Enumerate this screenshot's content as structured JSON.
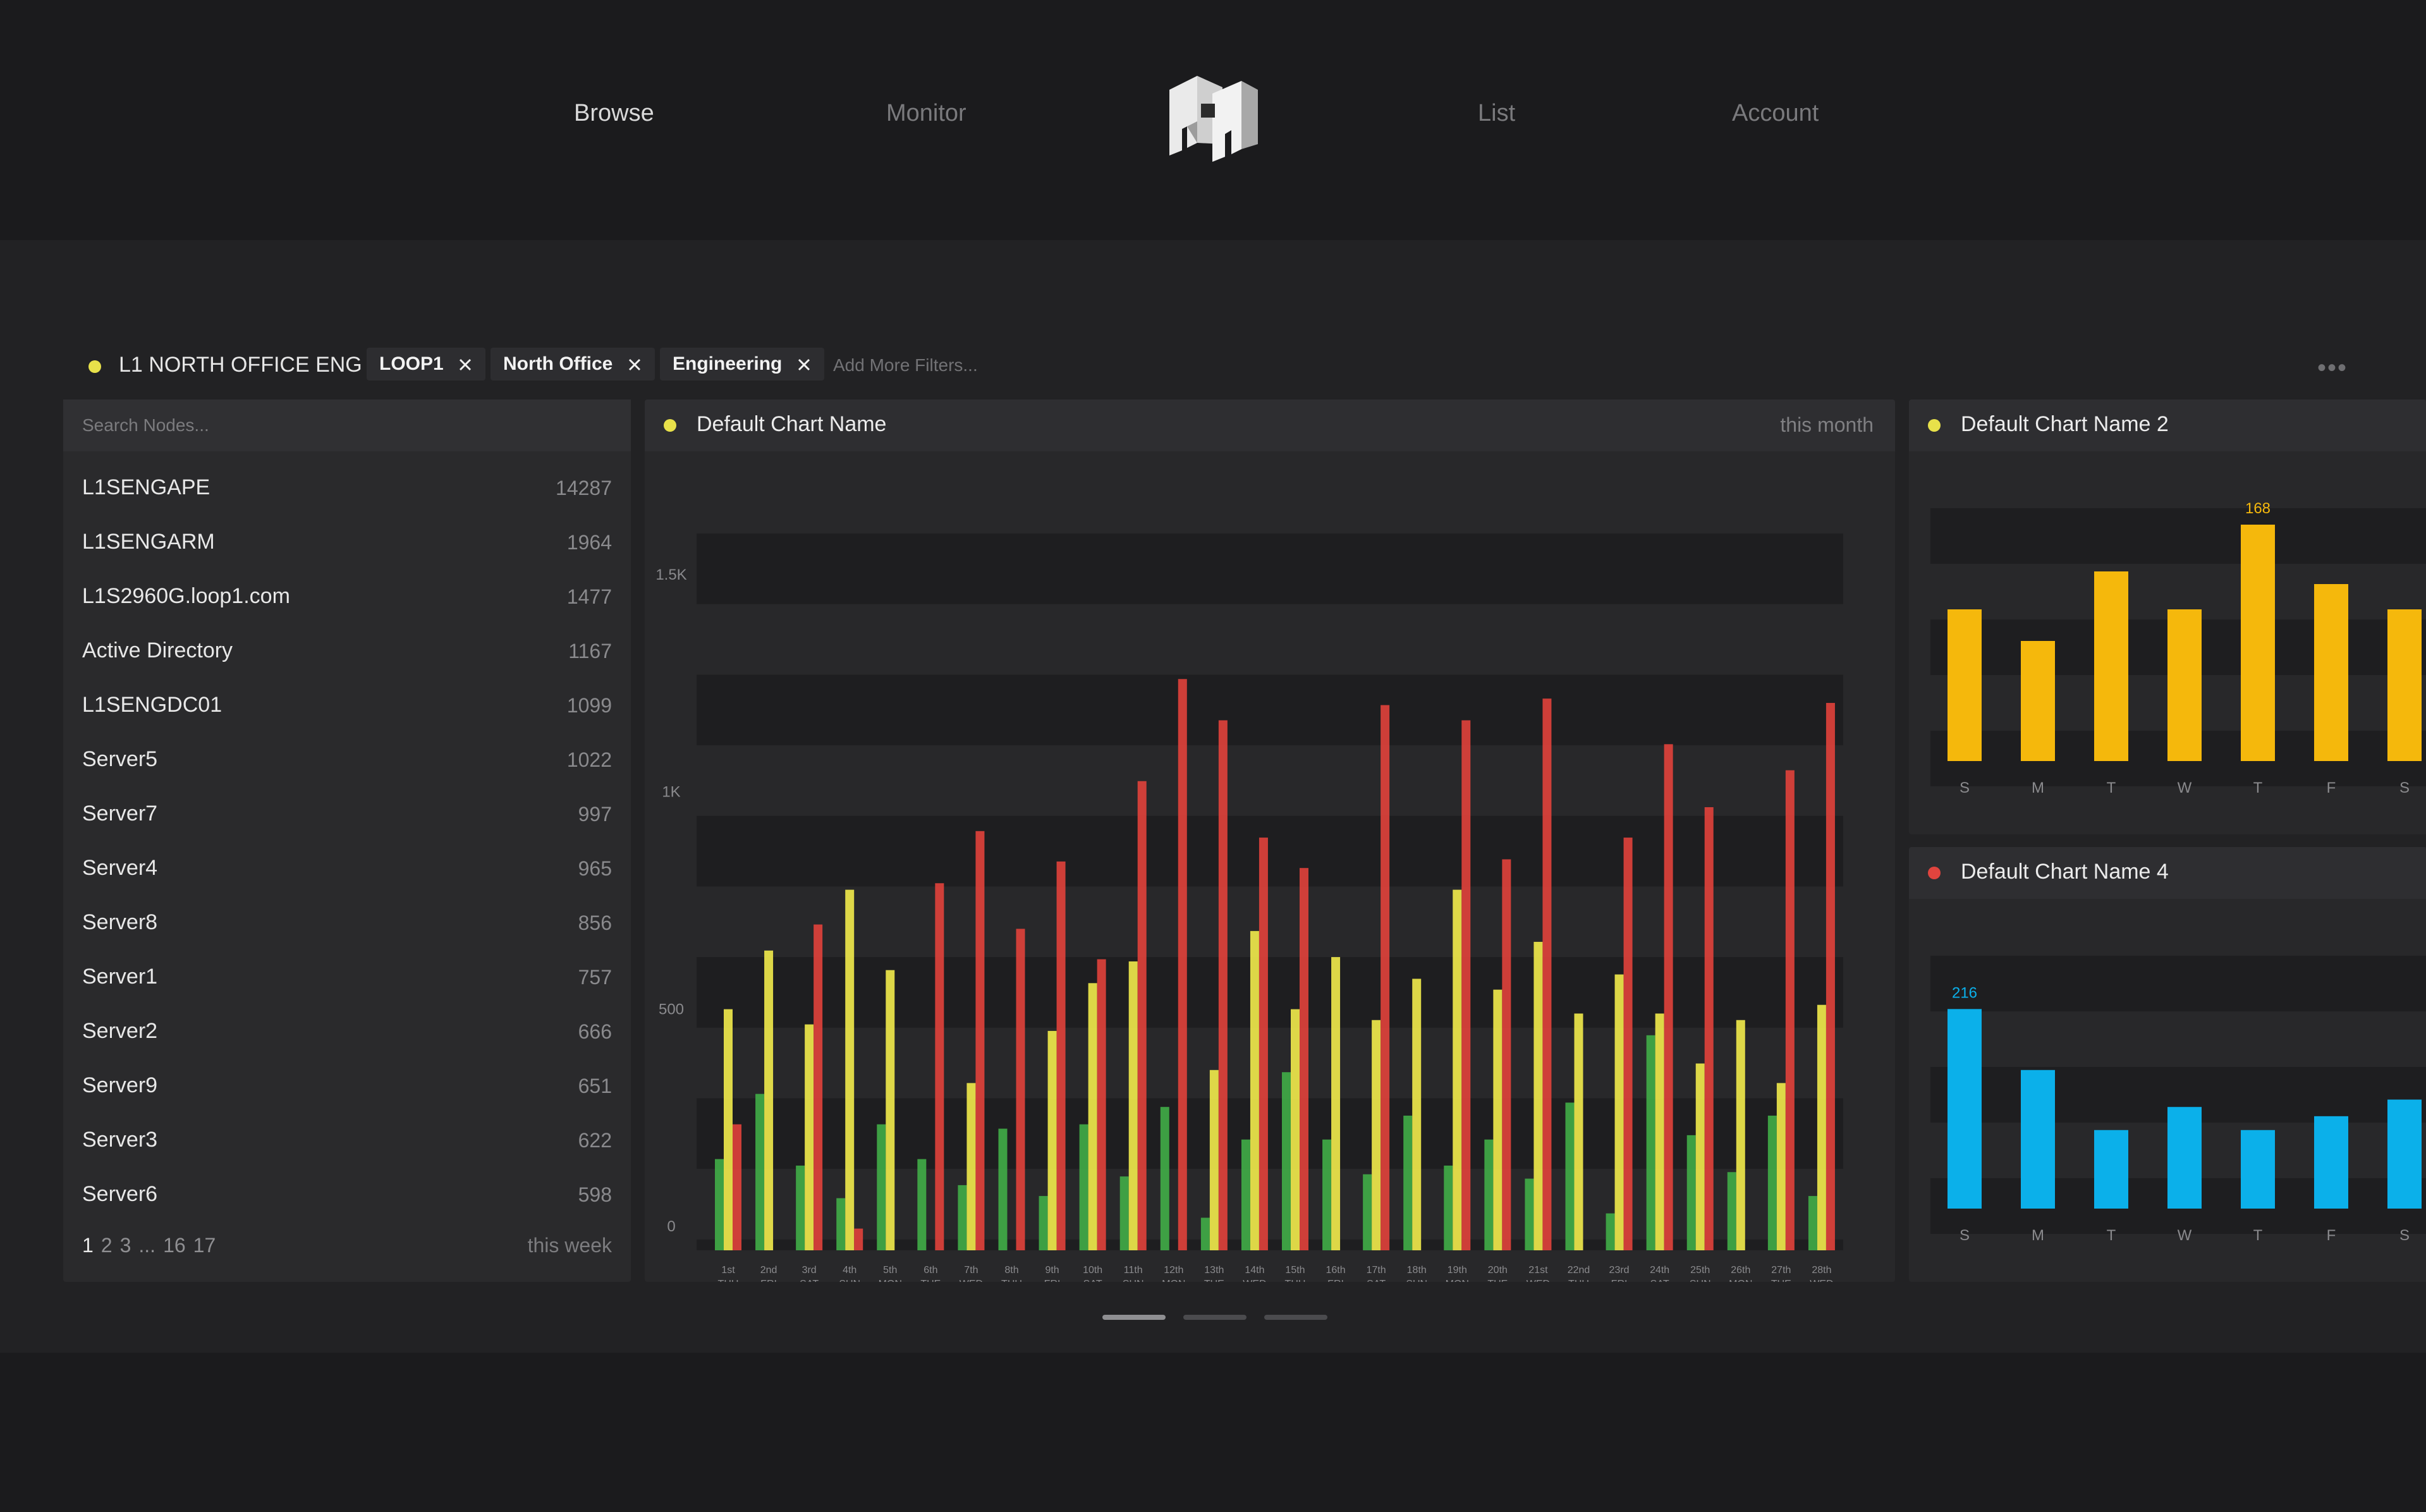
{
  "nav": {
    "items": [
      "Browse",
      "Monitor",
      "List",
      "Account"
    ],
    "active": "Browse"
  },
  "filters": {
    "title": "L1 NORTH OFFICE ENG",
    "title_color": "#e8e14a",
    "chips": [
      "LOOP1",
      "North Office",
      "Engineering"
    ],
    "add_placeholder": "Add More Filters...",
    "more_icon": "more-dots-icon"
  },
  "nodes": {
    "search_placeholder": "Search Nodes...",
    "items": [
      {
        "name": "L1SENGAPE",
        "count": "14287"
      },
      {
        "name": "L1SENGARM",
        "count": "1964"
      },
      {
        "name": "L1S2960G.loop1.com",
        "count": "1477"
      },
      {
        "name": "Active Directory",
        "count": "1167"
      },
      {
        "name": "L1SENGDC01",
        "count": "1099"
      },
      {
        "name": "Server5",
        "count": "1022"
      },
      {
        "name": "Server7",
        "count": "997"
      },
      {
        "name": "Server4",
        "count": "965"
      },
      {
        "name": "Server8",
        "count": "856"
      },
      {
        "name": "Server1",
        "count": "757"
      },
      {
        "name": "Server2",
        "count": "666"
      },
      {
        "name": "Server9",
        "count": "651"
      },
      {
        "name": "Server3",
        "count": "622"
      },
      {
        "name": "Server6",
        "count": "598"
      }
    ],
    "pages": [
      "1",
      "2",
      "3",
      "...",
      "16",
      "17"
    ],
    "current_page": "1",
    "period": "this week"
  },
  "main_panel": {
    "title": "Default Chart Name",
    "period": "this month",
    "dot_color": "#e8e14a"
  },
  "side_panels": [
    {
      "title": "Default Chart Name 2",
      "dot_color": "#e8e14a"
    },
    {
      "title": "Default Chart Name 4",
      "dot_color": "#e0443e"
    }
  ],
  "colors": {
    "green": "#3fa646",
    "yellow": "#e8e14a",
    "red": "#d8403a",
    "orange": "#f5b80c",
    "blue": "#0bb0ea"
  },
  "chart_data": [
    {
      "type": "bar",
      "title": "Default Chart Name",
      "y_ticks": [
        "0",
        "500",
        "1K",
        "1.5K"
      ],
      "ylim": [
        0,
        1650
      ],
      "categories": [
        [
          "1st",
          "THU"
        ],
        [
          "2nd",
          "FRI"
        ],
        [
          "3rd",
          "SAT"
        ],
        [
          "4th",
          "SUN"
        ],
        [
          "5th",
          "MON"
        ],
        [
          "6th",
          "TUE"
        ],
        [
          "7th",
          "WED"
        ],
        [
          "8th",
          "THU"
        ],
        [
          "9th",
          "FRI"
        ],
        [
          "10th",
          "SAT"
        ],
        [
          "11th",
          "SUN"
        ],
        [
          "12th",
          "MON"
        ],
        [
          "13th",
          "TUE"
        ],
        [
          "14th",
          "WED"
        ],
        [
          "15th",
          "THU"
        ],
        [
          "16th",
          "FRI"
        ],
        [
          "17th",
          "SAT"
        ],
        [
          "18th",
          "SUN"
        ],
        [
          "19th",
          "MON"
        ],
        [
          "20th",
          "TUE"
        ],
        [
          "21st",
          "WED"
        ],
        [
          "22nd",
          "THU"
        ],
        [
          "23rd",
          "FRI"
        ],
        [
          "24th",
          "SAT"
        ],
        [
          "25th",
          "SUN"
        ],
        [
          "26th",
          "MON"
        ],
        [
          "27th",
          "TUE"
        ],
        [
          "28th",
          "WED"
        ]
      ],
      "series": [
        {
          "color": "green",
          "values": [
            210,
            360,
            195,
            120,
            290,
            210,
            150,
            280,
            125,
            290,
            170,
            330,
            75,
            255,
            410,
            255,
            175,
            310,
            195,
            255,
            165,
            340,
            85,
            495,
            265,
            180,
            310,
            125
          ]
        },
        {
          "color": "yellow",
          "values": [
            555,
            690,
            520,
            830,
            645,
            0,
            385,
            0,
            505,
            615,
            665,
            0,
            415,
            735,
            555,
            675,
            530,
            625,
            830,
            600,
            710,
            545,
            635,
            545,
            430,
            530,
            385,
            565
          ]
        },
        {
          "color": "red",
          "values": [
            290,
            0,
            750,
            50,
            0,
            845,
            965,
            740,
            895,
            670,
            1080,
            1315,
            1220,
            950,
            880,
            0,
            1255,
            0,
            1220,
            900,
            1270,
            0,
            950,
            1165,
            1020,
            0,
            1105,
            1260
          ]
        }
      ]
    },
    {
      "type": "bar",
      "title": "Default Chart Name 2",
      "categories": [
        "S",
        "M",
        "T",
        "W",
        "T",
        "F",
        "S"
      ],
      "values": [
        120,
        95,
        150,
        120,
        187,
        140,
        120
      ],
      "ylim": [
        0,
        190
      ],
      "labels": {
        "4": "168"
      },
      "color": "orange"
    },
    {
      "type": "bar",
      "title": "Default Chart Name 4",
      "categories": [
        "S",
        "M",
        "T",
        "W",
        "T",
        "F",
        "S"
      ],
      "values": [
        216,
        150,
        85,
        110,
        85,
        100,
        118
      ],
      "ylim": [
        0,
        260
      ],
      "labels": {
        "0": "216"
      },
      "color": "blue"
    }
  ]
}
